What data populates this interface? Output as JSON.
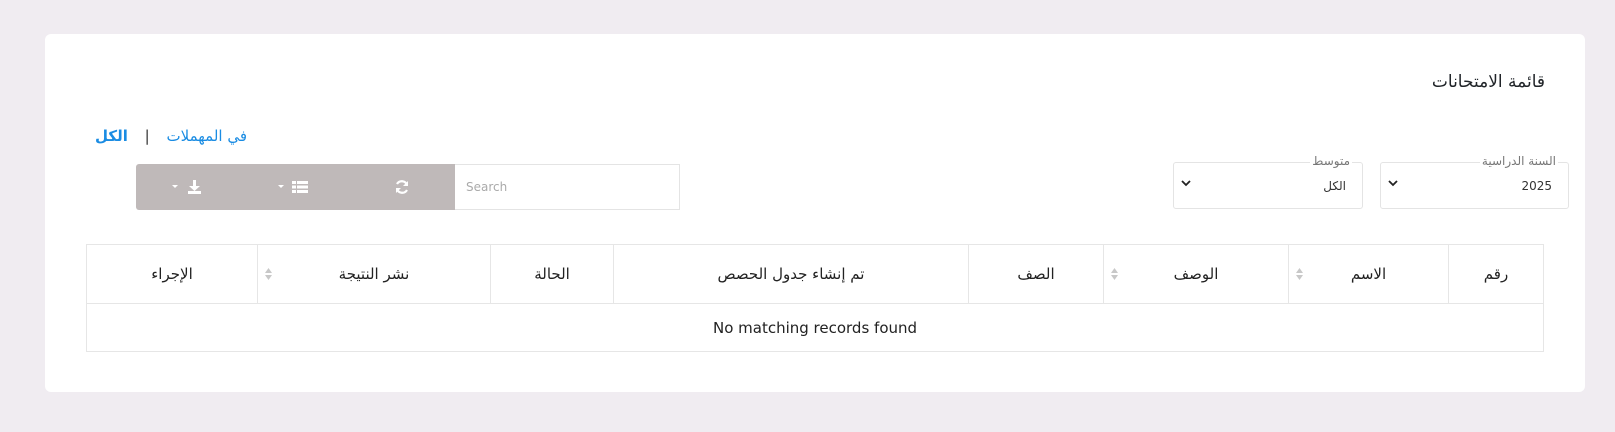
{
  "page": {
    "title": "قائمة الامتحانات"
  },
  "filters": {
    "all_label": "الكل",
    "separator": "|",
    "trash_label": "في المهملات"
  },
  "selects": {
    "year": {
      "legend": "السنة الدراسية",
      "value": "2025"
    },
    "level": {
      "legend": "متوسط",
      "value": "الكل"
    }
  },
  "toolbar": {
    "search_placeholder": "Search",
    "icons": [
      "refresh-icon",
      "list-columns-icon",
      "download-icon"
    ],
    "colors": {
      "button_bg": "#bfb9b9",
      "link": "#1a8ce3"
    }
  },
  "table": {
    "columns": [
      {
        "label": "رقم",
        "sortable": false
      },
      {
        "label": "الاسم",
        "sortable": true
      },
      {
        "label": "الوصف",
        "sortable": true
      },
      {
        "label": "الصف",
        "sortable": false
      },
      {
        "label": "تم إنشاء جدول الحصص",
        "sortable": false
      },
      {
        "label": "الحالة",
        "sortable": false
      },
      {
        "label": "نشر النتيجة",
        "sortable": true
      },
      {
        "label": "الإجراء",
        "sortable": false
      }
    ],
    "empty_message": "No matching records found"
  }
}
